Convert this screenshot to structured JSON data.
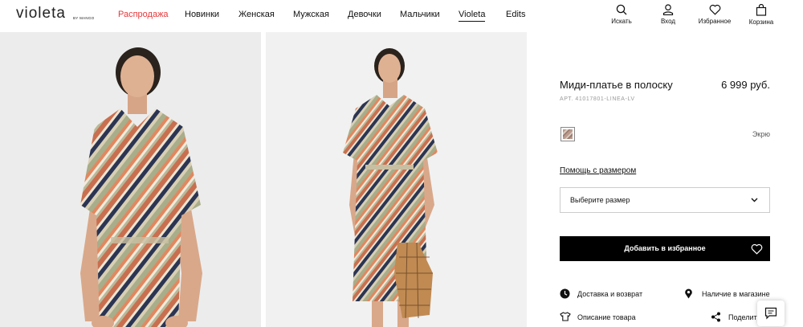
{
  "header": {
    "logo": "violeta",
    "logo_sub": "BY MANGO",
    "nav": [
      {
        "label": "Распродажа"
      },
      {
        "label": "Новинки"
      },
      {
        "label": "Женская"
      },
      {
        "label": "Мужская"
      },
      {
        "label": "Девочки"
      },
      {
        "label": "Мальчики"
      },
      {
        "label": "Violeta"
      },
      {
        "label": "Edits"
      }
    ],
    "tools": [
      {
        "label": "Искать",
        "icon": "search-icon"
      },
      {
        "label": "Вход",
        "icon": "user-icon"
      },
      {
        "label": "Избранное",
        "icon": "heart-icon"
      },
      {
        "label": "Корзина",
        "icon": "bag-icon"
      }
    ]
  },
  "product": {
    "title": "Миди-платье в полоску",
    "price": "6 999 руб.",
    "ref": "АРТ. 41017801-LINEA-LV",
    "color_name": "Экрю",
    "size_help": "Помощь с размером",
    "size_placeholder": "Выберите размер",
    "add_to_favorites": "Добавить в избранное"
  },
  "links": {
    "delivery": "Доставка и возврат",
    "store_availability": "Наличие в магазине",
    "description": "Описание товара",
    "share": "Поделит"
  },
  "colors": {
    "sale": "#e4393c",
    "button_bg": "#000000",
    "photo_bg": "#ededed"
  }
}
